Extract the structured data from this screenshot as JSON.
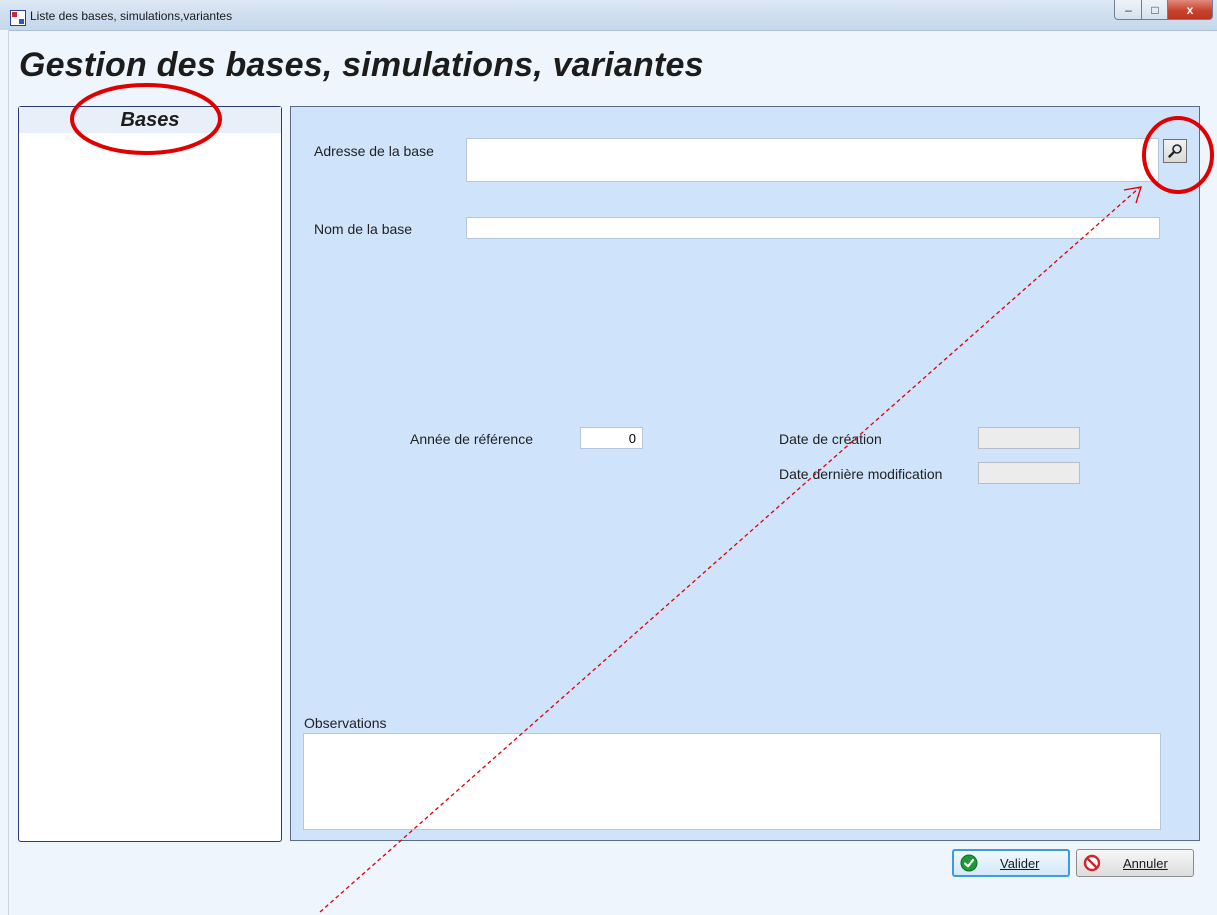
{
  "window": {
    "title": "Liste des bases, simulations,variantes",
    "controls": {
      "minimize": "–",
      "maximize": "□",
      "close": "x"
    }
  },
  "page": {
    "title": "Gestion des bases, simulations, variantes"
  },
  "bases_panel": {
    "header": "Bases",
    "items": []
  },
  "form": {
    "adresse_label": "Adresse de la base",
    "adresse_value": "",
    "nom_label": "Nom de la base",
    "nom_value": "",
    "annee_label": "Année de référence",
    "annee_value": "0",
    "date_creation_label": "Date de création",
    "date_creation_value": "",
    "date_modif_label": "Date dernière modification",
    "date_modif_value": "",
    "observations_label": "Observations",
    "observations_value": ""
  },
  "buttons": {
    "valider": "Valider",
    "annuler": "Annuler"
  },
  "icons": {
    "browse": "magnifier-icon",
    "valider": "checkmark-icon",
    "annuler": "cancel-icon"
  },
  "colors": {
    "annotation": "#e00000",
    "panel_bg": "#cfe3fb",
    "valider_border": "#3c9be0"
  }
}
